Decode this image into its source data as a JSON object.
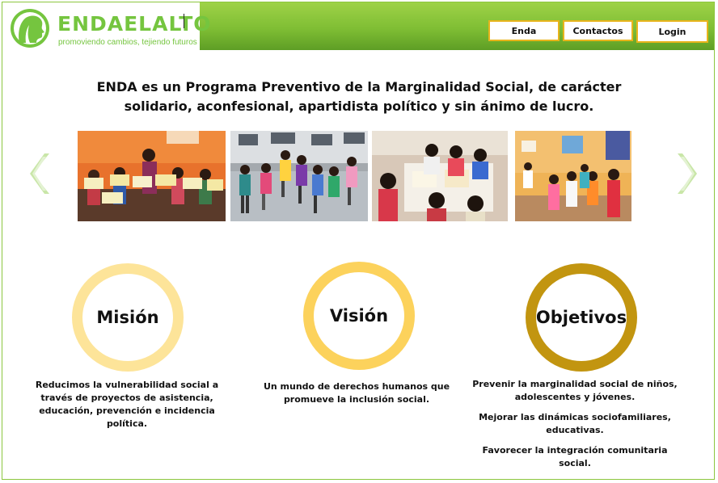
{
  "logo": {
    "brand": "ENDAELALTO",
    "tagline": "promoviendo cambios, tejiendo futuros",
    "icon": "woman-profile-icon",
    "color": "#75c53f"
  },
  "nav": {
    "enda_label": "Enda",
    "contactos_label": "Contactos",
    "login_label": "Login"
  },
  "headline": "ENDA es un Programa Preventivo de la Marginalidad Social, de carácter solidario, aconfesional, apartidista político y sin ánimo de lucro.",
  "carousel": {
    "prev_icon": "chevron-left-icon",
    "next_icon": "chevron-right-icon",
    "photos": [
      "children-holding-papers",
      "children-jumping-outdoors",
      "children-drawing-at-table",
      "children-in-classroom"
    ]
  },
  "sections": {
    "mision": {
      "title": "Misión",
      "text": "Reducimos la vulnerabilidad social a través de proyectos de asistencia, educación, prevención e incidencia política.",
      "ring_color": "#fde499"
    },
    "vision": {
      "title": "Visión",
      "text": "Un mundo de derechos humanos que promueve la inclusión social.",
      "ring_color": "#fcd25c"
    },
    "objetivos": {
      "title": "Objetivos",
      "items": [
        "Prevenir la marginalidad social de niños, adolescentes y jóvenes.",
        "Mejorar las dinámicas sociofamiliares, educativas.",
        "Favorecer la integración comunitaria social."
      ],
      "ring_color": "#c29510"
    }
  },
  "colors": {
    "header_green": "#7fbe34",
    "nav_border": "#e8b41c",
    "frame_green": "#8cc63f"
  }
}
